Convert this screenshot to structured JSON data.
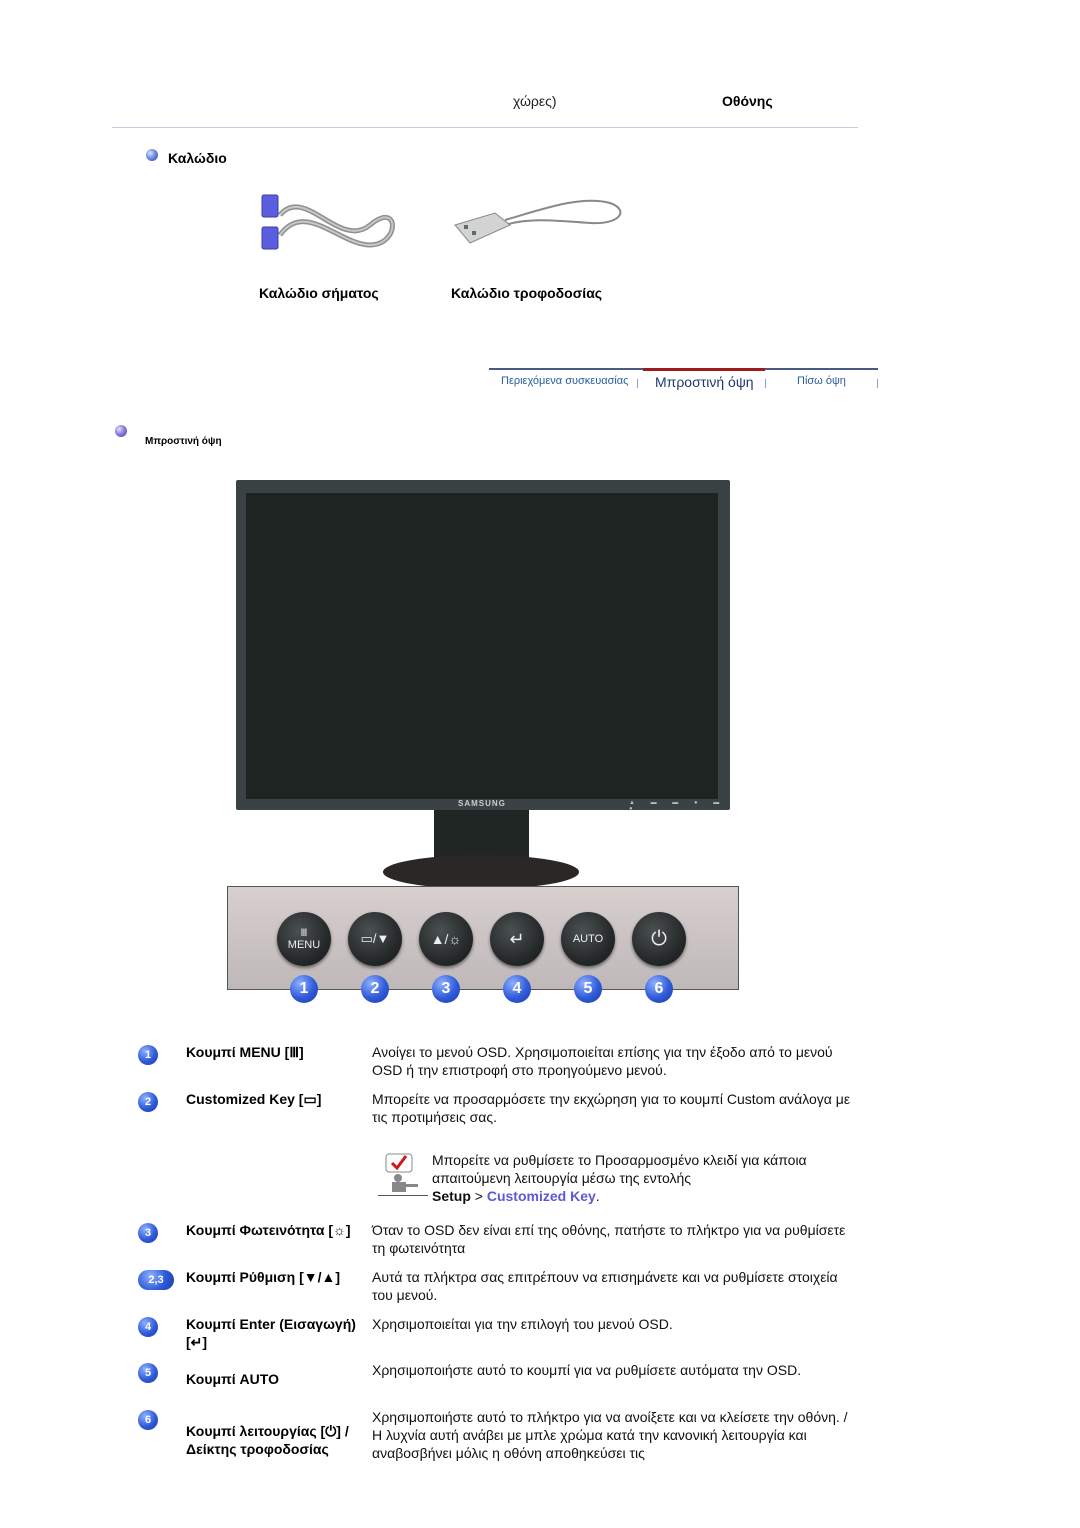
{
  "header": {
    "left_text": "χώρες)",
    "right_text": "Οθόνης"
  },
  "cables": {
    "section_title": "Καλώδιο",
    "items": [
      {
        "label": "Καλώδιο σήματος",
        "icon": "signal-cable-icon"
      },
      {
        "label": "Καλώδιο τροφοδοσίας",
        "icon": "power-cable-icon"
      }
    ]
  },
  "tabs": [
    {
      "label": "Περιεχόμενα συσκευασίας",
      "active": false
    },
    {
      "label": "Μπροστινή όψη",
      "active": true
    },
    {
      "label": "Πίσω όψη",
      "active": false
    }
  ],
  "front_view": {
    "section_title": "Μπροστινή όψη",
    "monitor_brand": "SAMSUNG",
    "hardware_buttons": [
      {
        "number": "1",
        "label": "MENU",
        "icon": "menu-icon"
      },
      {
        "number": "2",
        "label": "▭/▼",
        "icon": "customized-key-down-icon"
      },
      {
        "number": "3",
        "label": "▲/☼",
        "icon": "up-brightness-icon"
      },
      {
        "number": "4",
        "label": "↵",
        "icon": "enter-icon"
      },
      {
        "number": "5",
        "label": "AUTO",
        "icon": "auto-icon"
      },
      {
        "number": "6",
        "label": "⏻",
        "icon": "power-icon"
      }
    ]
  },
  "descriptions": [
    {
      "badge": "1",
      "label": "Κουμπί MENU [Ⅲ]",
      "text": "Ανοίγει το μενού OSD. Χρησιμοποιείται επίσης για την έξοδο από το μενού OSD ή την επιστροφή στο προηγούμενο μενού."
    },
    {
      "badge": "2",
      "label": "Customized Key [▭]",
      "text": "Μπορείτε να προσαρμόσετε την εκχώρηση για το κουμπί Custom ανάλογα με τις προτιμήσεις σας."
    },
    {
      "badge": "3",
      "label": "Κουμπί Φωτεινότητα [☼]",
      "text": "Όταν το OSD δεν είναι επί της οθόνης, πατήστε το πλήκτρο για να ρυθμίσετε τη φωτεινότητα"
    },
    {
      "badge": "2,3",
      "label": "Κουμπί Ρύθμιση [▼/▲]",
      "text": "Αυτά τα πλήκτρα σας επιτρέπουν να επισημάνετε και να ρυθμίσετε στοιχεία του μενού."
    },
    {
      "badge": "4",
      "label": "Κουμπί Enter (Εισαγωγή)[↵]",
      "text": "Χρησιμοποιείται για την επιλογή του μενού OSD."
    },
    {
      "badge": "5",
      "label": "Κουμπί AUTO",
      "text": "Χρησιμοποιήστε αυτό το κουμπί για να ρυθμίσετε αυτόματα την OSD."
    },
    {
      "badge": "6",
      "label": "Κουμπί λειτουργίας [⏻] / Δείκτης τροφοδοσίας",
      "text": "Χρησιμοποιήστε αυτό το πλήκτρο για να ανοίξετε και να κλείσετε την οθόνη. /",
      "text2": "Η λυχνία αυτή ανάβει με μπλε χρώμα κατά την κανονική λειτουργία και αναβοσβήνει μόλις η οθόνη αποθηκεύσει τις"
    }
  ],
  "note": {
    "text": "Μπορείτε να ρυθμίσετε το Προσαρμοσμένο κλειδί για κάποια απαιτούμενη λειτουργία μέσω της εντολής",
    "setup": "Setup",
    "separator": ">",
    "link": "Customized Key",
    "end": "."
  },
  "colors": {
    "link": "#5a5ad6",
    "tab_active_line": "#9c1b1b",
    "tab_text": "#2a5a9c",
    "badge": "#2f5ad8"
  }
}
